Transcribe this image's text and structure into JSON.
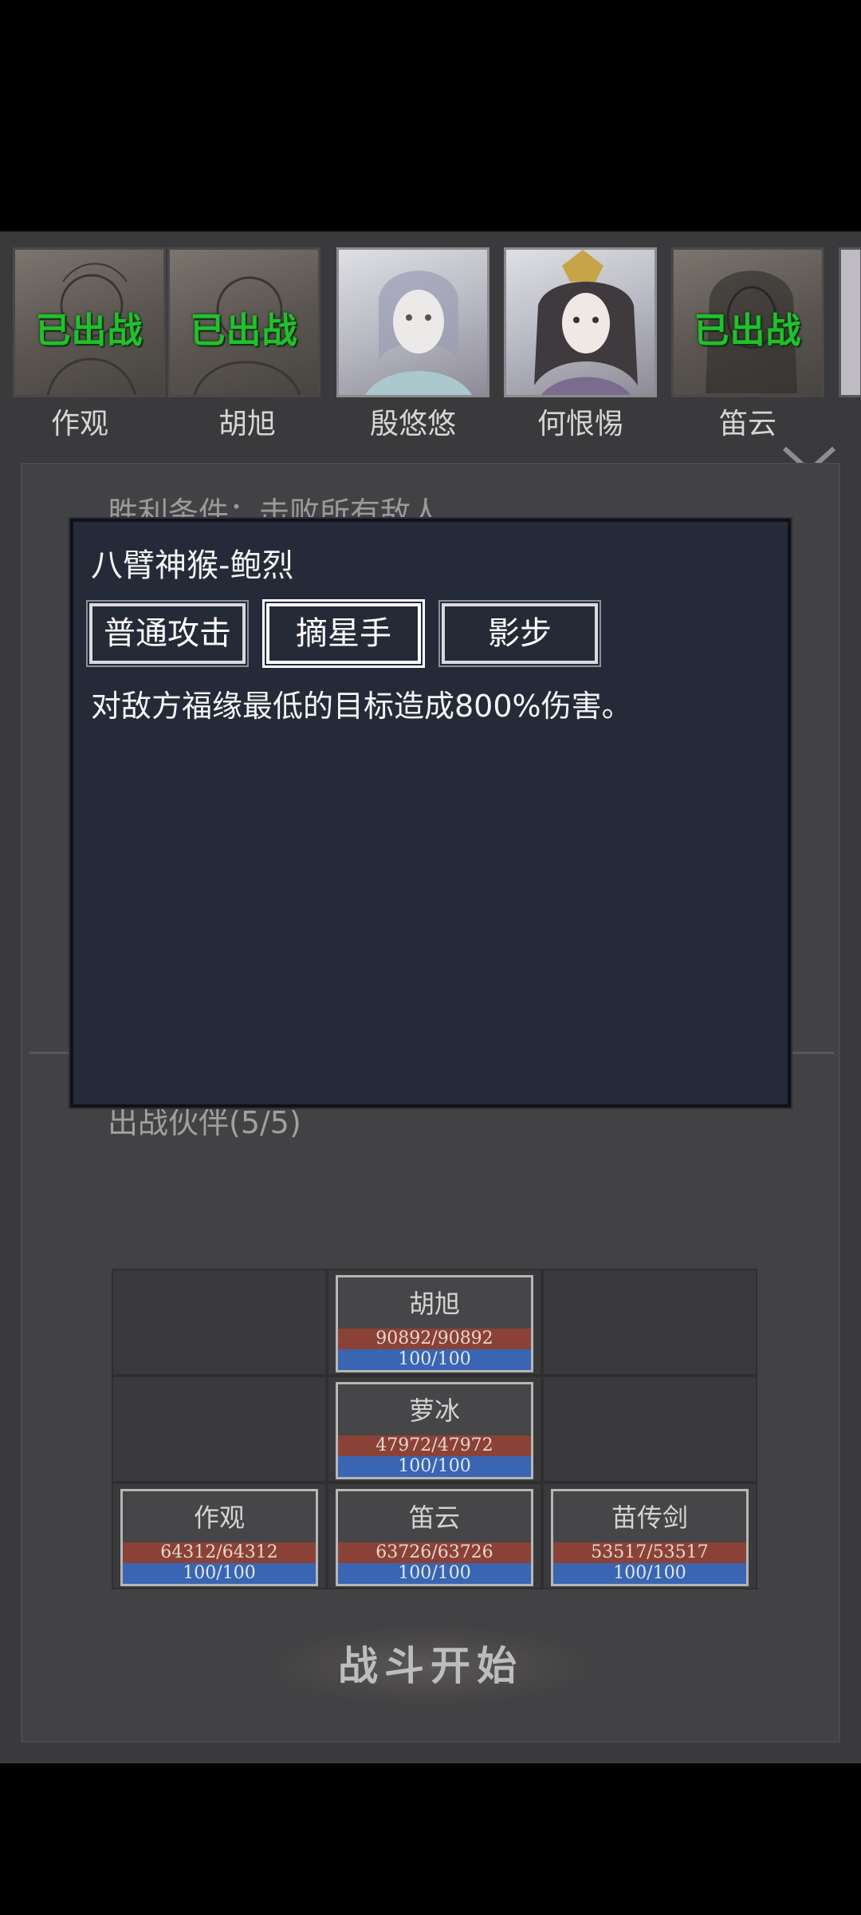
{
  "roster": [
    {
      "name": "作观",
      "status": "已出战",
      "deployed": true
    },
    {
      "name": "胡旭",
      "status": "已出战",
      "deployed": true
    },
    {
      "name": "殷悠悠",
      "status": "",
      "deployed": false
    },
    {
      "name": "何恨惕",
      "status": "",
      "deployed": false
    },
    {
      "name": "笛云",
      "status": "已出战",
      "deployed": true
    }
  ],
  "battle": {
    "victory_condition": "胜利条件：击败所有敌人",
    "party_title": "出战伙伴(5/5)",
    "start_button": "战斗开始"
  },
  "formation": [
    {
      "name": "胡旭",
      "hp": "90892/90892",
      "mp": "100/100"
    },
    {
      "name": "萝冰",
      "hp": "47972/47972",
      "mp": "100/100"
    },
    {
      "name": "作观",
      "hp": "64312/64312",
      "mp": "100/100"
    },
    {
      "name": "笛云",
      "hp": "63726/63726",
      "mp": "100/100"
    },
    {
      "name": "苗传剑",
      "hp": "53517/53517",
      "mp": "100/100"
    }
  ],
  "popup": {
    "title": "八臂神猴-鲍烈",
    "tabs": [
      "普通攻击",
      "摘星手",
      "影步"
    ],
    "active_tab": "摘星手",
    "description": "对敌方福缘最低的目标造成800%伤害。"
  },
  "colors": {
    "deployed_text": "#21c12c",
    "hp_bar": "#8b4236",
    "mp_bar": "#3a65b2",
    "popup_bg": "#242a38"
  }
}
